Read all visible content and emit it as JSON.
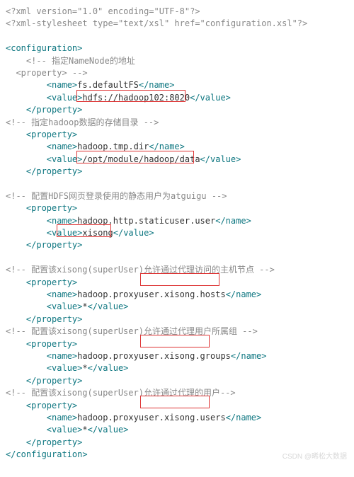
{
  "xml_decl": "<?xml version=\"1.0\" encoding=\"UTF-8\"?>",
  "xsl_decl": "<?xml-stylesheet type=\"text/xsl\" href=\"configuration.xsl\"?>",
  "open_config": "<configuration>",
  "close_config": "</configuration>",
  "open_prop": "    <property>",
  "close_prop": "    </property>",
  "c1": "    <!-- 指定NameNode的地址",
  "c1b": "  <property> -->",
  "n1a": "        <name>",
  "n1v": "fs.defaultFS",
  "n1b": "</name>",
  "v1a": "        <value>",
  "v1v": "hdfs://hadoop102:8020",
  "v1b": "</value>",
  "c2a": "<!-- 指定hadoop数据的存储目录 -->",
  "n2v": "hadoop.tmp.dir",
  "v2v": "/opt/module/hadoop/data",
  "c3a": "<!-- 配置HDFS网页登录使用的静态用户为atguigu -->",
  "n3v": "hadoop.http.staticuser.user",
  "v3pre": "        <val",
  "v3mid": "ue>",
  "v3v": "xisong",
  "v3cls": "</value>",
  "c4a": "<!-- 配置该xisong(superUser)允许通过代理访问的主机节点 -->",
  "n4pre": "        <name>",
  "n4a": "hadoop.proxyus",
  "n4b": "er.xisong.hosts",
  "n4cls": "</name>",
  "vstar_a": "        <value>",
  "vstar_v": "*",
  "vstar_b": "</value>",
  "c5a": "<!-- 配置该xisong(superUser)允许通过代理用户所属组 -->",
  "n5a": "hadoop.proxyus",
  "n5b": "er.xisong.gro",
  "n5c": "ups",
  "c6a": "<!-- 配置该xisong(superUser)允许通过代理的用户-->",
  "n6a": "hadoop.proxyus",
  "n6b": "er.xisong.use",
  "n6c": "rs",
  "watermark": "CSDN @晞松大数据",
  "chart_data": {
    "type": "table",
    "title": "Hadoop core-site.xml configuration",
    "properties": [
      {
        "name": "fs.defaultFS",
        "value": "hdfs://hadoop102:8020",
        "comment": "指定NameNode的地址"
      },
      {
        "name": "hadoop.tmp.dir",
        "value": "/opt/module/hadoop/data",
        "comment": "指定hadoop数据的存储目录"
      },
      {
        "name": "hadoop.http.staticuser.user",
        "value": "xisong",
        "comment": "配置HDFS网页登录使用的静态用户为atguigu"
      },
      {
        "name": "hadoop.proxyuser.xisong.hosts",
        "value": "*",
        "comment": "配置该xisong(superUser)允许通过代理访问的主机节点"
      },
      {
        "name": "hadoop.proxyuser.xisong.groups",
        "value": "*",
        "comment": "配置该xisong(superUser)允许通过代理用户所属组"
      },
      {
        "name": "hadoop.proxyuser.xisong.users",
        "value": "*",
        "comment": "配置该xisong(superUser)允许通过代理的用户"
      }
    ],
    "highlighted_values": [
      "hdfs://hadoop102:8020",
      "/opt/module/hadoop/data",
      "ue>xisong<",
      "er.xisong.hosts",
      "er.xisong.gro",
      "er.xisong.use"
    ]
  }
}
